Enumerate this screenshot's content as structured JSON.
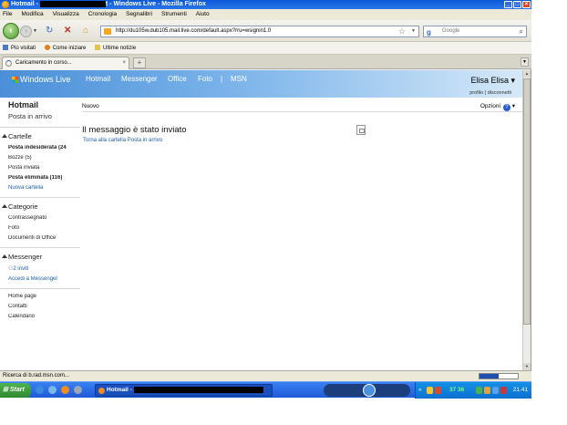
{
  "window": {
    "title_prefix": "Hotmail - ",
    "title_suffix": "t - Windows Live - Mozilla Firefox"
  },
  "menu": [
    "File",
    "Modifica",
    "Visualizza",
    "Cronologia",
    "Segnalibri",
    "Strumenti",
    "Aiuto"
  ],
  "address": {
    "url": "http://du105w.dub105.mail.live.com/default.aspx?rru=wsignin1.0",
    "search_placeholder": "Google"
  },
  "bookmarks": [
    "Più visitati",
    "Come iniziare",
    "Ultime notizie"
  ],
  "tab": {
    "label": "Caricamento in corso..."
  },
  "live": {
    "brand": "Windows Live",
    "nav": [
      "Hotmail",
      "Messenger",
      "Office",
      "Foto",
      "MSN"
    ],
    "user_name": "Elisa Elisa",
    "profile_link": "profilo",
    "logout_link": "disconnetti"
  },
  "sidebar": {
    "heading": "Hotmail",
    "inbox": "Posta in arrivo",
    "folders_title": "Cartelle",
    "folders": [
      {
        "label": "Posta indesiderata (24"
      },
      {
        "label": "Bozze (5)"
      },
      {
        "label": "Posta inviata"
      },
      {
        "label": "Posta eliminata (116)"
      },
      {
        "label": "Nuova cartella"
      }
    ],
    "categories_title": "Categorie",
    "categories": [
      "Contrassegnato",
      "Foto",
      "Documenti di Office"
    ],
    "messenger_title": "Messenger",
    "invites": "2 inviti",
    "messenger_login": "Accedi a Messenger",
    "footer": [
      "Home page",
      "Contatti",
      "Calendario"
    ]
  },
  "main": {
    "new_label": "Nuovo",
    "options_label": "Opzioni",
    "message_title": "Il messaggio è stato inviato",
    "back_link": "Torna alla cartella Posta in arrivo"
  },
  "status": {
    "text": "Ricerca di b.rad.msn.com...",
    "progress": 0.5
  },
  "taskbar": {
    "start": "Start",
    "task_prefix": "Hotmail - ",
    "temperature": "37 36",
    "clock": "21.41"
  },
  "colors": {
    "header_blue": "#4a8fd8",
    "link_blue": "#1a5fa8",
    "taskbar_blue": "#1f5ad8",
    "start_green": "#2f8a2f"
  }
}
